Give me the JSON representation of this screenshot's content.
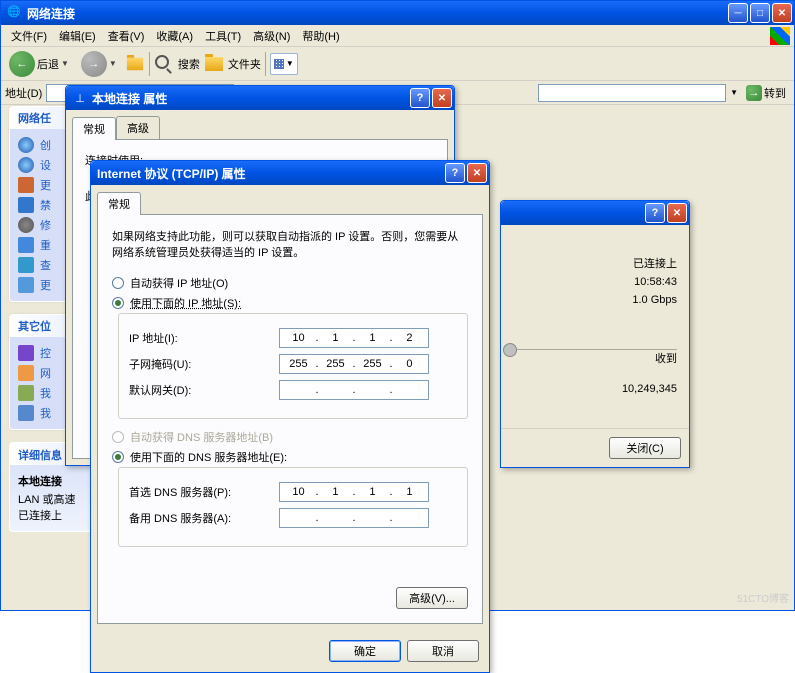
{
  "main_window": {
    "title": "网络连接",
    "menu": [
      "文件(F)",
      "编辑(E)",
      "查看(V)",
      "收藏(A)",
      "工具(T)",
      "高级(N)",
      "帮助(H)"
    ],
    "toolbar": {
      "back": "后退",
      "search": "搜索",
      "folders": "文件夹"
    },
    "addrbar": {
      "label": "地址(D)",
      "go": "转到"
    }
  },
  "side": {
    "tasks_header": "网络任",
    "tasks": [
      {
        "icon": "net",
        "label": "创"
      },
      {
        "icon": "net",
        "label": "设"
      },
      {
        "icon": "wall",
        "label": "更"
      },
      {
        "icon": "dis",
        "label": "禁"
      },
      {
        "icon": "cog",
        "label": "修"
      },
      {
        "icon": "ren",
        "label": "重"
      },
      {
        "icon": "view",
        "label": "查"
      },
      {
        "icon": "stat",
        "label": "更"
      }
    ],
    "other_header": "其它位",
    "other": [
      {
        "icon": "ctrl",
        "label": "控"
      },
      {
        "icon": "place",
        "label": "网"
      },
      {
        "icon": "doc",
        "label": "我"
      },
      {
        "icon": "comp",
        "label": "我"
      }
    ],
    "details_header": "详细信息",
    "details": {
      "title": "本地连接",
      "line1": "LAN 或高速",
      "line2": "已连接上"
    }
  },
  "status": {
    "connected": "已连接上",
    "duration": "10:58:43",
    "speed": "1.0 Gbps",
    "recv_label": "收到",
    "packets": "10,249,345",
    "close": "关闭(C)"
  },
  "props": {
    "title": "本地连接 属性",
    "tabs": [
      "常规",
      "高级"
    ],
    "connect_label": "连接时使用:",
    "this_label": "此"
  },
  "tcpip": {
    "title": "Internet 协议 (TCP/IP) 属性",
    "tab": "常规",
    "desc": "如果网络支持此功能，则可以获取自动指派的 IP 设置。否则，您需要从网络系统管理员处获得适当的 IP 设置。",
    "auto_ip": "自动获得 IP 地址(O)",
    "manual_ip": "使用下面的 IP 地址(S):",
    "ip_label": "IP 地址(I):",
    "mask_label": "子网掩码(U):",
    "gw_label": "默认网关(D):",
    "auto_dns": "自动获得 DNS 服务器地址(B)",
    "manual_dns": "使用下面的 DNS 服务器地址(E):",
    "dns1_label": "首选 DNS 服务器(P):",
    "dns2_label": "备用 DNS 服务器(A):",
    "ip": [
      "10",
      "1",
      "1",
      "2"
    ],
    "mask": [
      "255",
      "255",
      "255",
      "0"
    ],
    "gw": [
      "",
      "",
      "",
      ""
    ],
    "dns1": [
      "10",
      "1",
      "1",
      "1"
    ],
    "dns2": [
      "",
      "",
      "",
      ""
    ],
    "advanced": "高级(V)...",
    "ok": "确定",
    "cancel": "取消"
  },
  "watermark": "51CTO博客"
}
